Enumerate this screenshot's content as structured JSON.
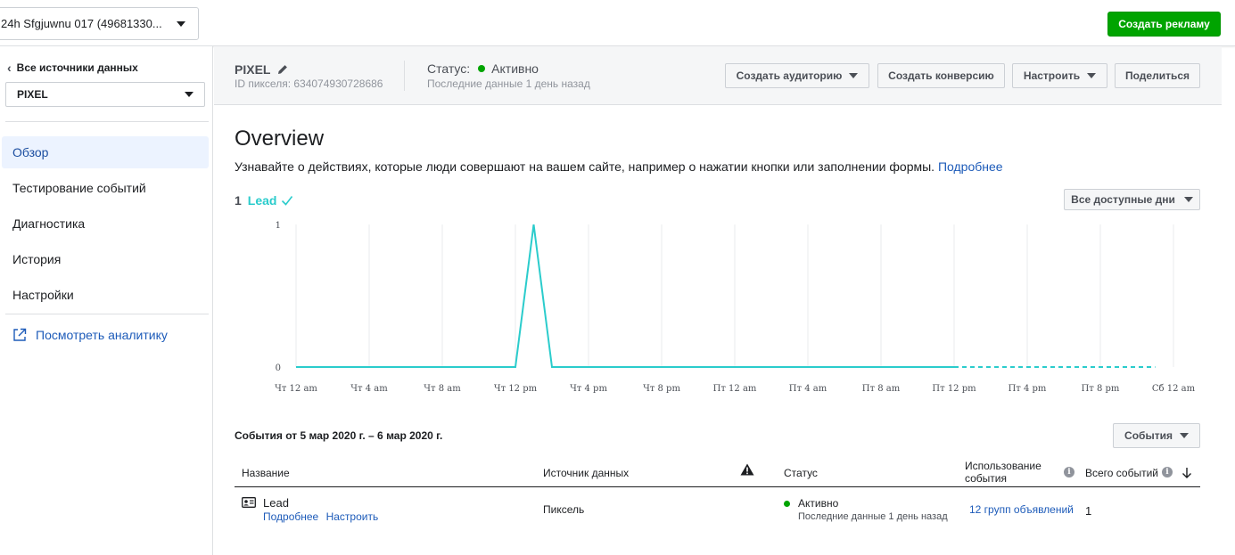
{
  "topbar": {
    "account_label": "24h Sfgjuwnu 017 (49681330...",
    "create_ad_label": "Создать рекламу"
  },
  "sidebar": {
    "back_label": "Все источники данных",
    "pixel_select": "PIXEL",
    "nav": [
      {
        "label": "Обзор",
        "active": true
      },
      {
        "label": "Тестирование событий",
        "active": false
      },
      {
        "label": "Диагностика",
        "active": false
      },
      {
        "label": "История",
        "active": false
      },
      {
        "label": "Настройки",
        "active": false
      }
    ],
    "analytics_link": "Посмотреть аналитику"
  },
  "header": {
    "pixel_name": "PIXEL",
    "pixel_id": "ID пикселя: 634074930728686",
    "status_label": "Статус:",
    "status_value": "Активно",
    "status_sub": "Последние данные 1 день назад",
    "status_color": "#00a400",
    "buttons": {
      "create_audience": "Создать аудиторию",
      "create_conversion": "Создать конверсию",
      "configure": "Настроить",
      "share": "Поделиться"
    }
  },
  "overview": {
    "title": "Overview",
    "description": "Узнавайте о действиях, которые люди совершают на вашем сайте, например о нажатии кнопки или заполнении формы.",
    "learn_more": "Подробнее"
  },
  "legend": {
    "count": "1",
    "event_name": "Lead",
    "color": "#2bcccc"
  },
  "days_dropdown": "Все доступные дни",
  "chart_data": {
    "type": "line",
    "x": [
      "Чт 12 am",
      "Чт 4 am",
      "Чт 8 am",
      "Чт 12 pm",
      "Чт 4 pm",
      "Чт 8 pm",
      "Пт 12 am",
      "Пт 4 am",
      "Пт 8 am",
      "Пт 12 pm",
      "Пт 4 pm",
      "Пт 8 pm",
      "Сб 12 am"
    ],
    "series": [
      {
        "name": "Lead",
        "points": [
          {
            "t": 0,
            "v": 0
          },
          {
            "t": 3,
            "v": 0
          },
          {
            "t": 3.25,
            "v": 1
          },
          {
            "t": 3.5,
            "v": 0
          },
          {
            "t": 9,
            "v": 0
          }
        ],
        "projected_points": [
          {
            "t": 9,
            "v": 0
          },
          {
            "t": 11.75,
            "v": 0
          }
        ]
      }
    ],
    "yticks": [
      "0",
      "1"
    ],
    "ylim": [
      0,
      1
    ],
    "grid": true,
    "color": "#2bcccc"
  },
  "events_table": {
    "title": "События от 5 мар 2020 г. – 6 мар 2020 г.",
    "filter_button": "События",
    "headers": {
      "name": "Название",
      "source": "Источник данных",
      "status": "Статус",
      "usage_line1": "Использование",
      "usage_line2": "события",
      "total": "Всего событий"
    },
    "rows": [
      {
        "name": "Lead",
        "link_details": "Подробнее",
        "link_configure": "Настроить",
        "source": "Пиксель",
        "status": "Активно",
        "status_sub": "Последние данные 1 день назад",
        "usage": "12 групп объявлений",
        "total": "1"
      }
    ]
  }
}
